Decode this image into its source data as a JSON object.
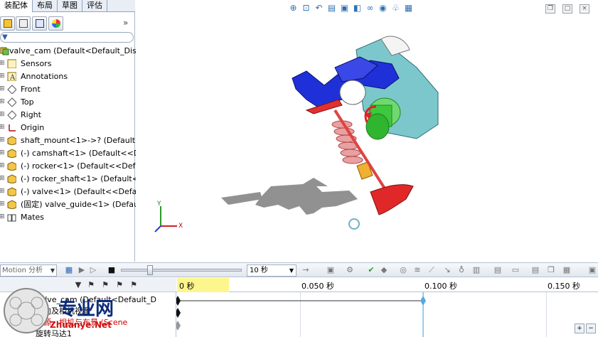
{
  "tabs": [
    "装配体",
    "布局",
    "草图",
    "评估"
  ],
  "tree": {
    "root": "valve_cam  (Default<Default_Displ",
    "items": [
      {
        "label": "Sensors",
        "icon": "sensors-icon"
      },
      {
        "label": "Annotations",
        "icon": "annotations-icon"
      },
      {
        "label": "Front",
        "icon": "plane-icon"
      },
      {
        "label": "Top",
        "icon": "plane-icon"
      },
      {
        "label": "Right",
        "icon": "plane-icon"
      },
      {
        "label": "Origin",
        "icon": "origin-icon"
      },
      {
        "label": "shaft_mount<1>->? (Default<",
        "icon": "part-icon"
      },
      {
        "label": "(-) camshaft<1> (Default<<De",
        "icon": "part-icon"
      },
      {
        "label": "(-) rocker<1> (Default<<Defa",
        "icon": "part-icon"
      },
      {
        "label": "(-) rocker_shaft<1> (Default<<",
        "icon": "part-icon"
      },
      {
        "label": "(-) valve<1> (Default<<Defaul",
        "icon": "part-icon"
      },
      {
        "label": "(固定) valve_guide<1> (Defaul",
        "icon": "part-icon"
      },
      {
        "label": "Mates",
        "icon": "mates-icon"
      }
    ]
  },
  "motion": {
    "study_type": "Motion 分析",
    "playback_speed": "10 秒"
  },
  "motion_tree": {
    "rows": [
      "valve_cam  (Default<Default_D",
      "视向及相机视图",
      "光源、相机与布景 (Scene",
      "旋转马达1"
    ]
  },
  "timeline": {
    "ticks": [
      "0 秒",
      "0.050 秒",
      "0.100 秒",
      "0.150 秒"
    ]
  },
  "triad": {
    "x": "X",
    "y": "Y"
  },
  "watermark": {
    "cn": "专业网",
    "en": "Zhuanye.Net"
  }
}
